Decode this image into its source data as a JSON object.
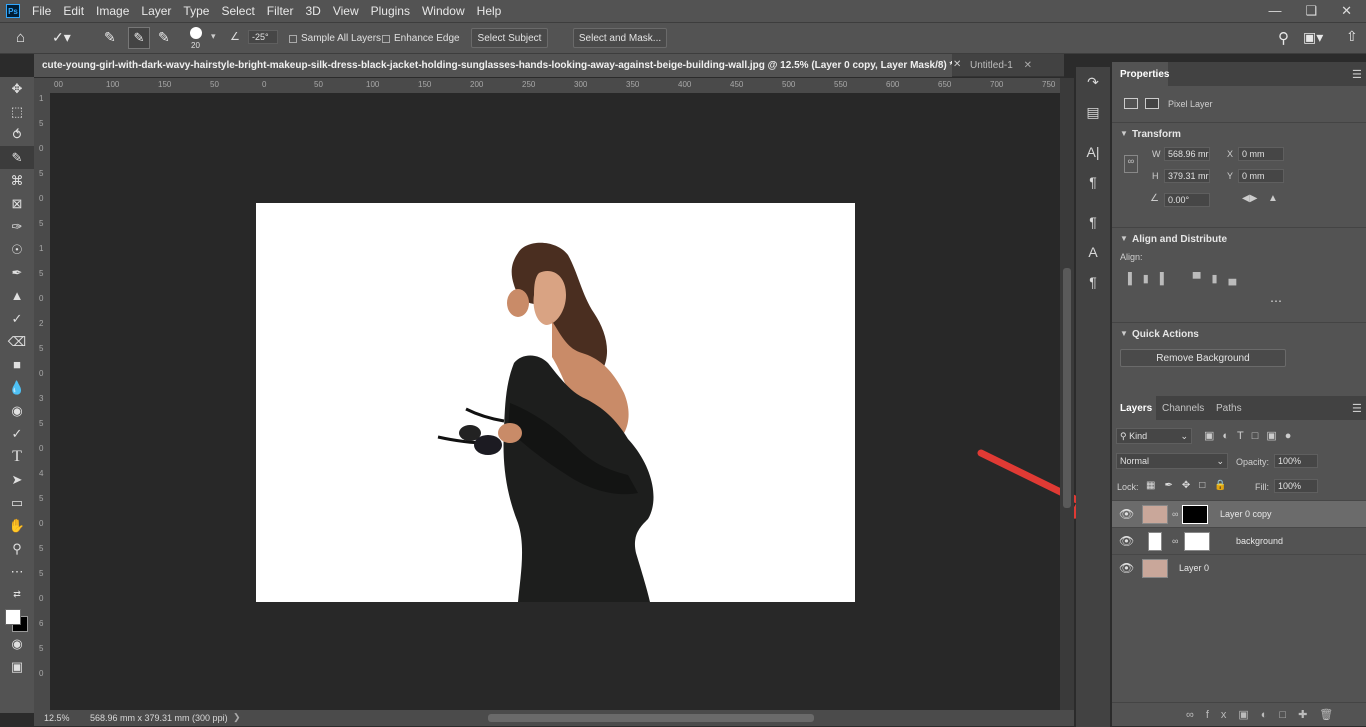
{
  "menu": {
    "app_icon": "Ps",
    "items": [
      "File",
      "Edit",
      "Image",
      "Layer",
      "Type",
      "Select",
      "Filter",
      "3D",
      "View",
      "Plugins",
      "Window",
      "Help"
    ]
  },
  "options": {
    "brush_size": "20",
    "angle_value": "-25°",
    "sample_all_layers": "Sample All Layers",
    "enhance_edge": "Enhance Edge",
    "select_subject": "Select Subject",
    "select_and_mask": "Select and Mask..."
  },
  "tabs": {
    "active": "cute-young-girl-with-dark-wavy-hairstyle-bright-makeup-silk-dress-black-jacket-holding-sunglasses-hands-looking-away-against-beige-building-wall.jpg @ 12.5% (Layer 0 copy, Layer Mask/8) *",
    "second": "Untitled-1"
  },
  "ruler": {
    "h": [
      "00",
      "100",
      "150",
      "50",
      "0",
      "50",
      "100",
      "150",
      "200",
      "250",
      "300",
      "350",
      "400",
      "450",
      "500",
      "550",
      "600",
      "650",
      "700",
      "750"
    ],
    "v": [
      "1",
      "5",
      "0",
      "5",
      "0",
      "5",
      "1",
      "5",
      "0",
      "2",
      "5",
      "0",
      "3",
      "5",
      "0",
      "4",
      "5",
      "0",
      "5",
      "5",
      "0",
      "6",
      "5",
      "0"
    ]
  },
  "status": {
    "zoom": "12.5%",
    "doc_info": "568.96 mm x 379.31 mm (300 ppi)"
  },
  "properties": {
    "title": "Properties",
    "pixel_layer": "Pixel Layer",
    "transform": "Transform",
    "w_label": "W",
    "w_value": "568.96 mr",
    "h_label": "H",
    "h_value": "379.31 mr",
    "x_label": "X",
    "x_value": "0 mm",
    "y_label": "Y",
    "y_value": "0 mm",
    "angle": "0.00°",
    "align_distribute": "Align and Distribute",
    "align_label": "Align:",
    "quick_actions": "Quick Actions",
    "remove_bg": "Remove Background"
  },
  "layers": {
    "tabs": [
      "Layers",
      "Channels",
      "Paths"
    ],
    "kind": "Kind",
    "blend": "Normal",
    "opacity_label": "Opacity:",
    "opacity": "100%",
    "lock_label": "Lock:",
    "fill_label": "Fill:",
    "fill": "100%",
    "items": [
      "Layer 0 copy",
      "background",
      "Layer 0"
    ]
  },
  "colors": {
    "arrow": "#e03a34",
    "panel": "#535353",
    "canvas": "#282828"
  }
}
